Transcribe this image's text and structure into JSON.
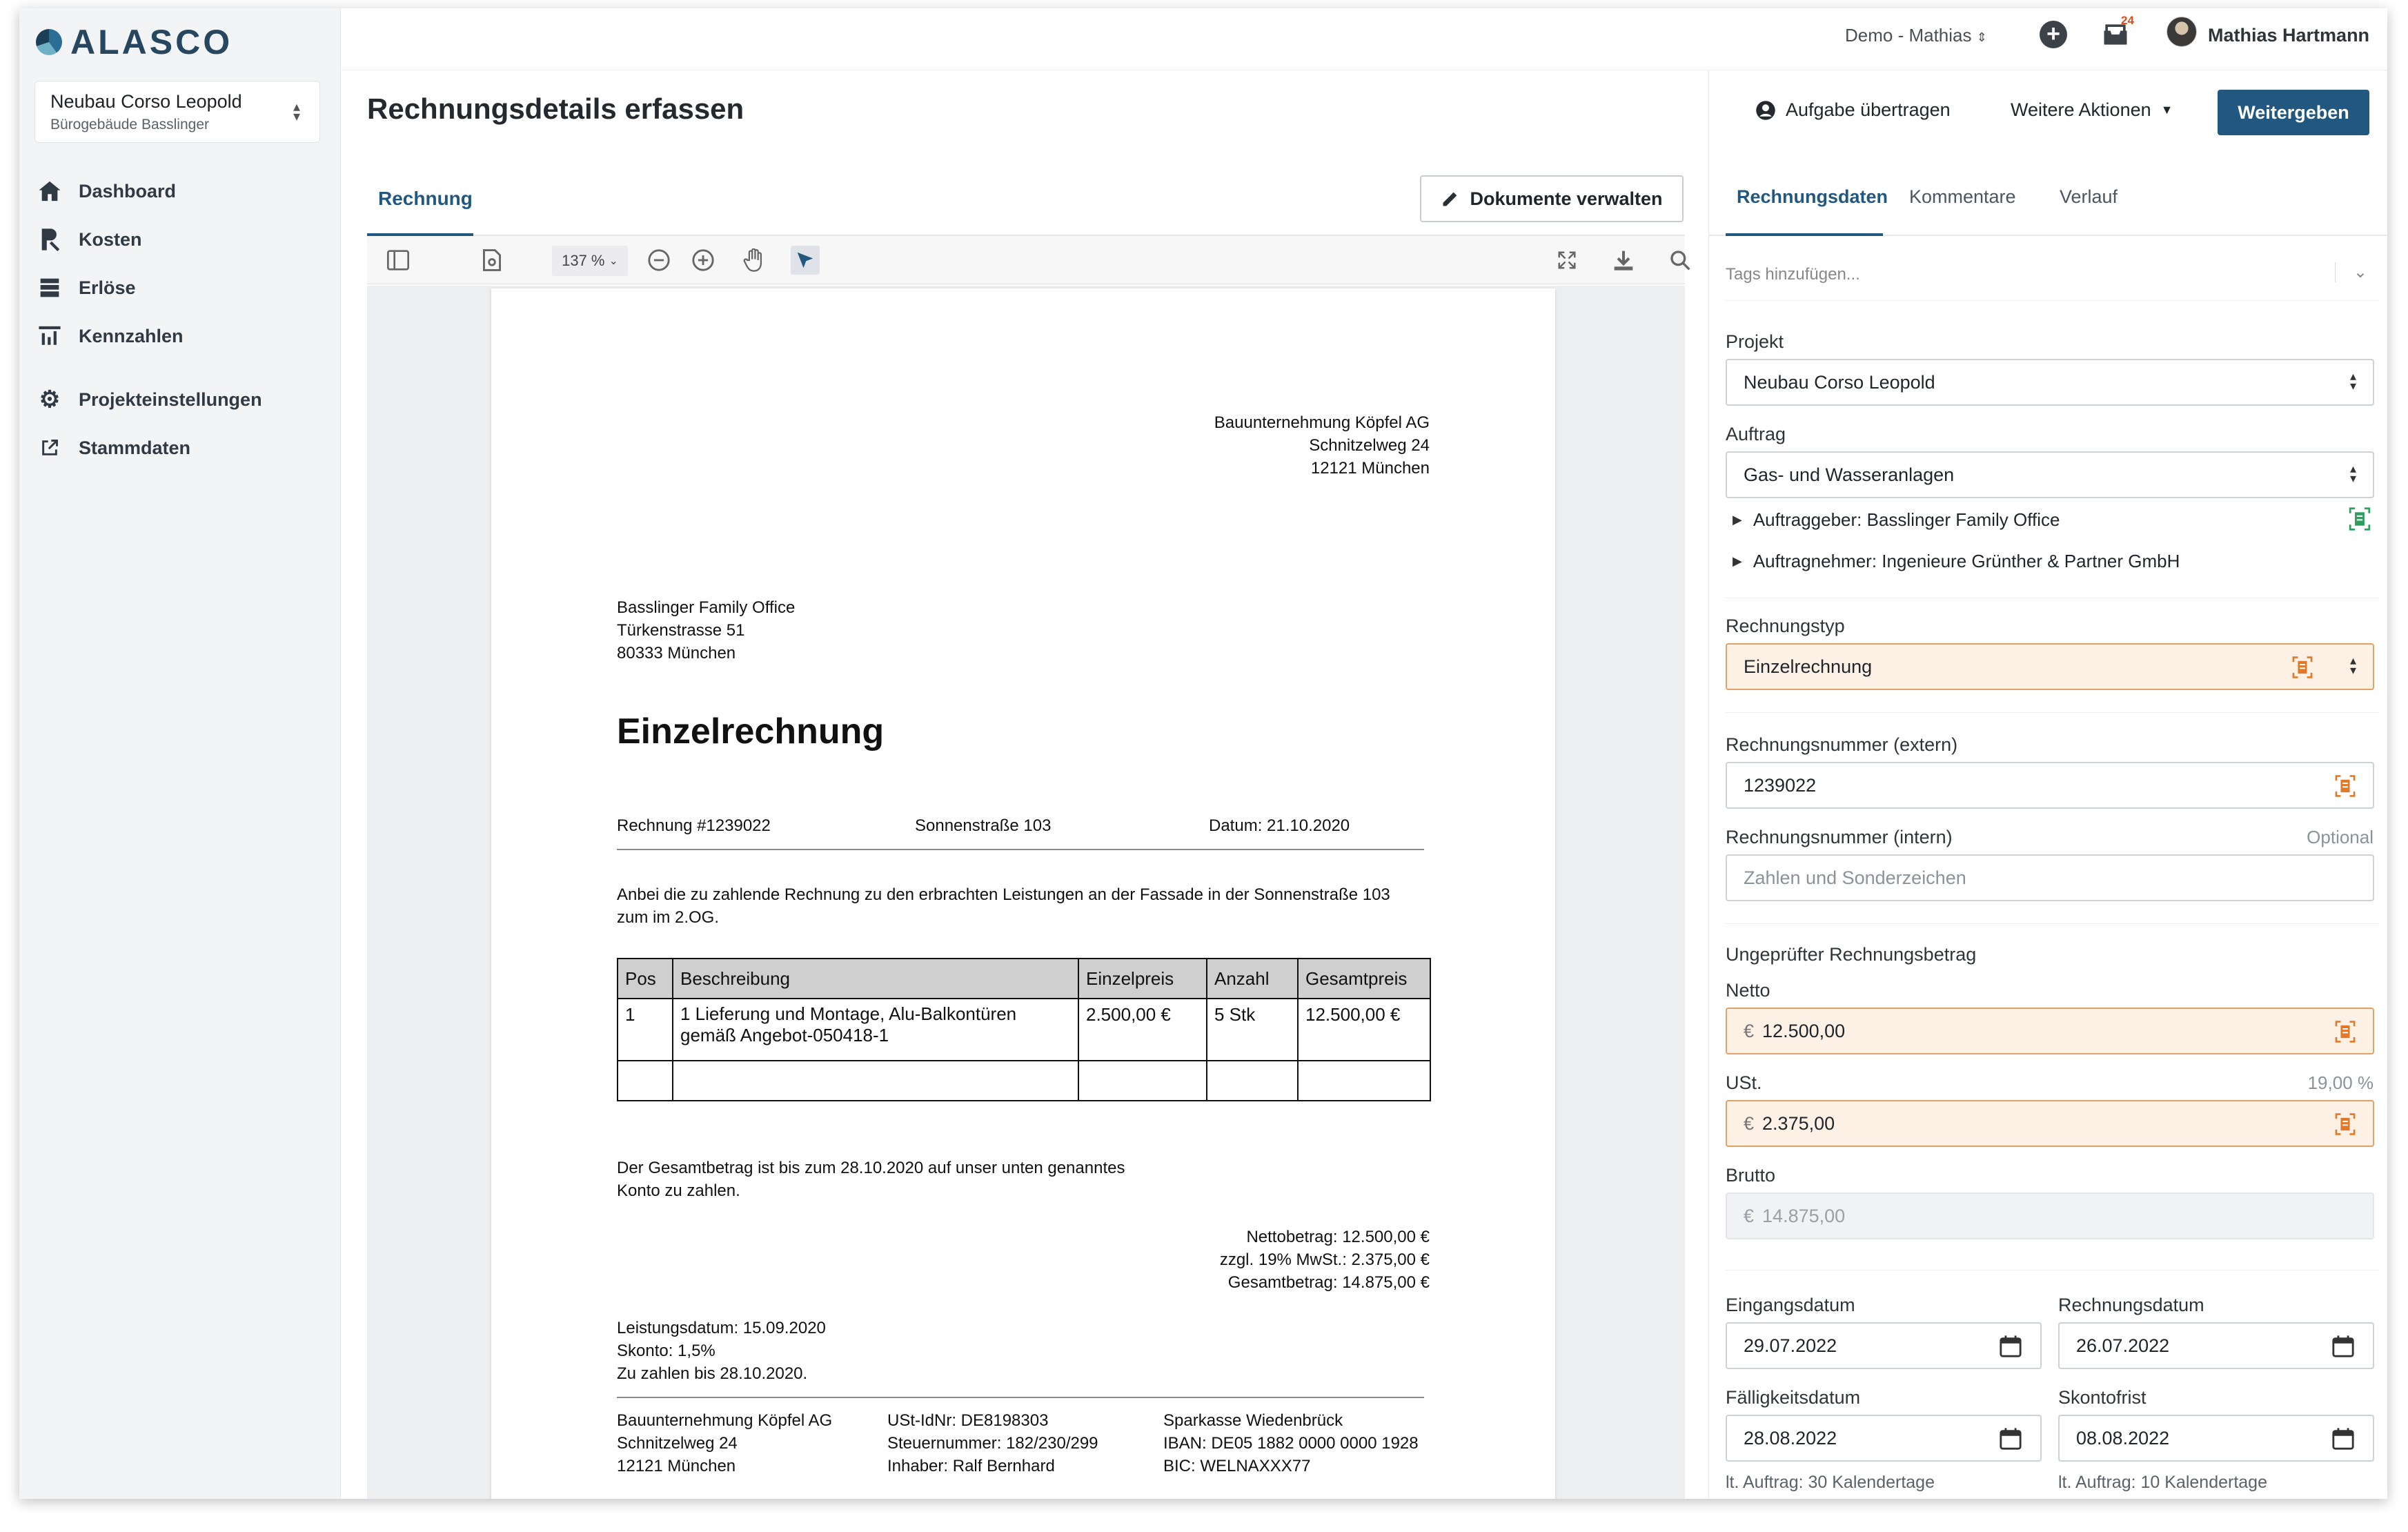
{
  "app": {
    "logo": "ALASCO"
  },
  "sidebar": {
    "project": {
      "title": "Neubau Corso Leopold",
      "subtitle": "Bürogebäude Basslinger"
    },
    "items": [
      {
        "label": "Dashboard",
        "icon": "home-icon"
      },
      {
        "label": "Kosten",
        "icon": "cost-icon"
      },
      {
        "label": "Erlöse",
        "icon": "revenue-icon"
      },
      {
        "label": "Kennzahlen",
        "icon": "chart-icon"
      },
      {
        "label": "Projekteinstellungen",
        "icon": "gear-icon"
      },
      {
        "label": "Stammdaten",
        "icon": "external-link-icon"
      }
    ]
  },
  "topbar": {
    "workspace": "Demo - Mathias",
    "notification_count": "24",
    "user": "Mathias Hartmann"
  },
  "header": {
    "title": "Rechnungsdetails erfassen",
    "transfer_task": "Aufgabe übertragen",
    "more_actions": "Weitere Aktionen",
    "forward": "Weitergeben"
  },
  "viewer": {
    "tab": "Rechnung",
    "manage_docs": "Dokumente verwalten",
    "zoom": "137 %"
  },
  "invoice": {
    "sender": [
      "Bauunternehmung Köpfel AG",
      "Schnitzelweg 24",
      "12121 München"
    ],
    "recipient": [
      "Basslinger Family Office",
      "Türkenstrasse 51",
      "80333 München"
    ],
    "title": "Einzelrechnung",
    "number": "Rechnung #1239022",
    "street": "Sonnenstraße 103",
    "date": "Datum: 21.10.2020",
    "intro1": "Anbei die zu zahlende Rechnung zu den erbrachten Leistungen an der Fassade in der Sonnenstraße 103",
    "intro2": "zum im 2.OG.",
    "table_headers": [
      "Pos",
      "Beschreibung",
      "Einzelpreis",
      "Anzahl",
      "Gesamtpreis"
    ],
    "row": {
      "pos": "1",
      "desc1": "1 Lieferung und Montage, Alu-Balkontüren",
      "desc2": "gemäß Angebot-050418-1",
      "unit": "2.500,00 €",
      "qty": "5 Stk",
      "total": "12.500,00 €"
    },
    "due1": "Der Gesamtbetrag ist bis zum 28.10.2020 auf unser unten genanntes",
    "due2": "Konto zu zahlen.",
    "net": "Nettobetrag: 12.500,00 €",
    "vat": "zzgl. 19% MwSt.: 2.375,00 €",
    "gross": "Gesamtbetrag: 14.875,00 €",
    "service_date": "Leistungsdatum: 15.09.2020",
    "discount": "Skonto: 1,5%",
    "pay_by": "Zu zahlen bis 28.10.2020.",
    "footer_col1": [
      "Bauunternehmung Köpfel AG",
      "Schnitzelweg 24",
      "12121 München"
    ],
    "footer_col2": [
      "USt-IdNr: DE8198303",
      "Steuernummer: 182/230/299",
      "Inhaber: Ralf Bernhard"
    ],
    "footer_col3": [
      "Sparkasse Wiedenbrück",
      "IBAN: DE05 1882 0000 0000 1928",
      "BIC: WELNAXXX77"
    ]
  },
  "form": {
    "tabs": [
      "Rechnungsdaten",
      "Kommentare",
      "Verlauf"
    ],
    "tags_placeholder": "Tags hinzufügen...",
    "project_label": "Projekt",
    "project_value": "Neubau Corso Leopold",
    "order_label": "Auftrag",
    "order_value": "Gas- und Wasseranlagen",
    "client": "Auftraggeber: Basslinger Family Office",
    "contractor": "Auftragnehmer: Ingenieure Grünther & Partner GmbH",
    "type_label": "Rechnungstyp",
    "type_value": "Einzelrechnung",
    "ext_label": "Rechnungsnummer (extern)",
    "ext_value": "1239022",
    "int_label": "Rechnungsnummer (intern)",
    "optional": "Optional",
    "int_placeholder": "Zahlen und Sonderzeichen",
    "amount_label": "Ungeprüfter Rechnungsbetrag",
    "net_label": "Netto",
    "currency": "€",
    "net_value": "12.500,00",
    "vat_label": "USt.",
    "vat_rate": "19,00 %",
    "vat_value": "2.375,00",
    "gross_label": "Brutto",
    "gross_value": "14.875,00",
    "receipt_label": "Eingangsdatum",
    "receipt_value": "29.07.2022",
    "invdate_label": "Rechnungsdatum",
    "invdate_value": "26.07.2022",
    "due_label": "Fälligkeitsdatum",
    "due_value": "28.08.2022",
    "discount_label": "Skontofrist",
    "discount_value": "08.08.2022",
    "due_hint": "lt. Auftrag: 30 Kalendertage",
    "discount_hint": "lt. Auftrag: 10 Kalendertage"
  },
  "colors": {
    "primary": "#22587f",
    "warn_bg": "#fdf0e4",
    "ocr": "#e07a2a",
    "ocr_green": "#2e9e5e"
  }
}
